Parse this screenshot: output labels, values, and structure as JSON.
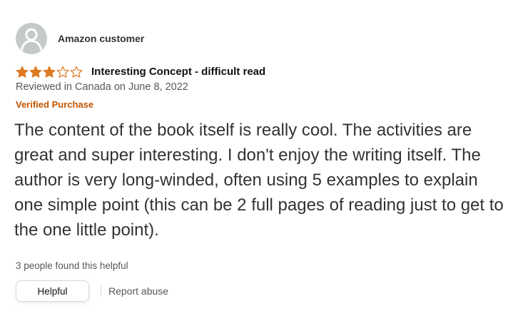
{
  "reviewer": {
    "name": "Amazon customer"
  },
  "review": {
    "rating": 3,
    "rating_max": 5,
    "title": "Interesting Concept - difficult read",
    "date_line": "Reviewed in Canada on June 8, 2022",
    "verified_label": "Verified Purchase",
    "body": "The content of the book itself is really cool. The activities are great and super interesting. I don't enjoy the writing itself. The author is very long-winded, often using 5 examples to explain one simple point (this can be 2 full pages of reading just to get to the one little point)."
  },
  "feedback": {
    "helpful_count_text": "3 people found this helpful",
    "helpful_button_label": "Helpful",
    "report_label": "Report abuse"
  },
  "colors": {
    "star_fill": "#de7921",
    "verified": "#c45500",
    "avatar_bg": "#c4c9ca"
  }
}
